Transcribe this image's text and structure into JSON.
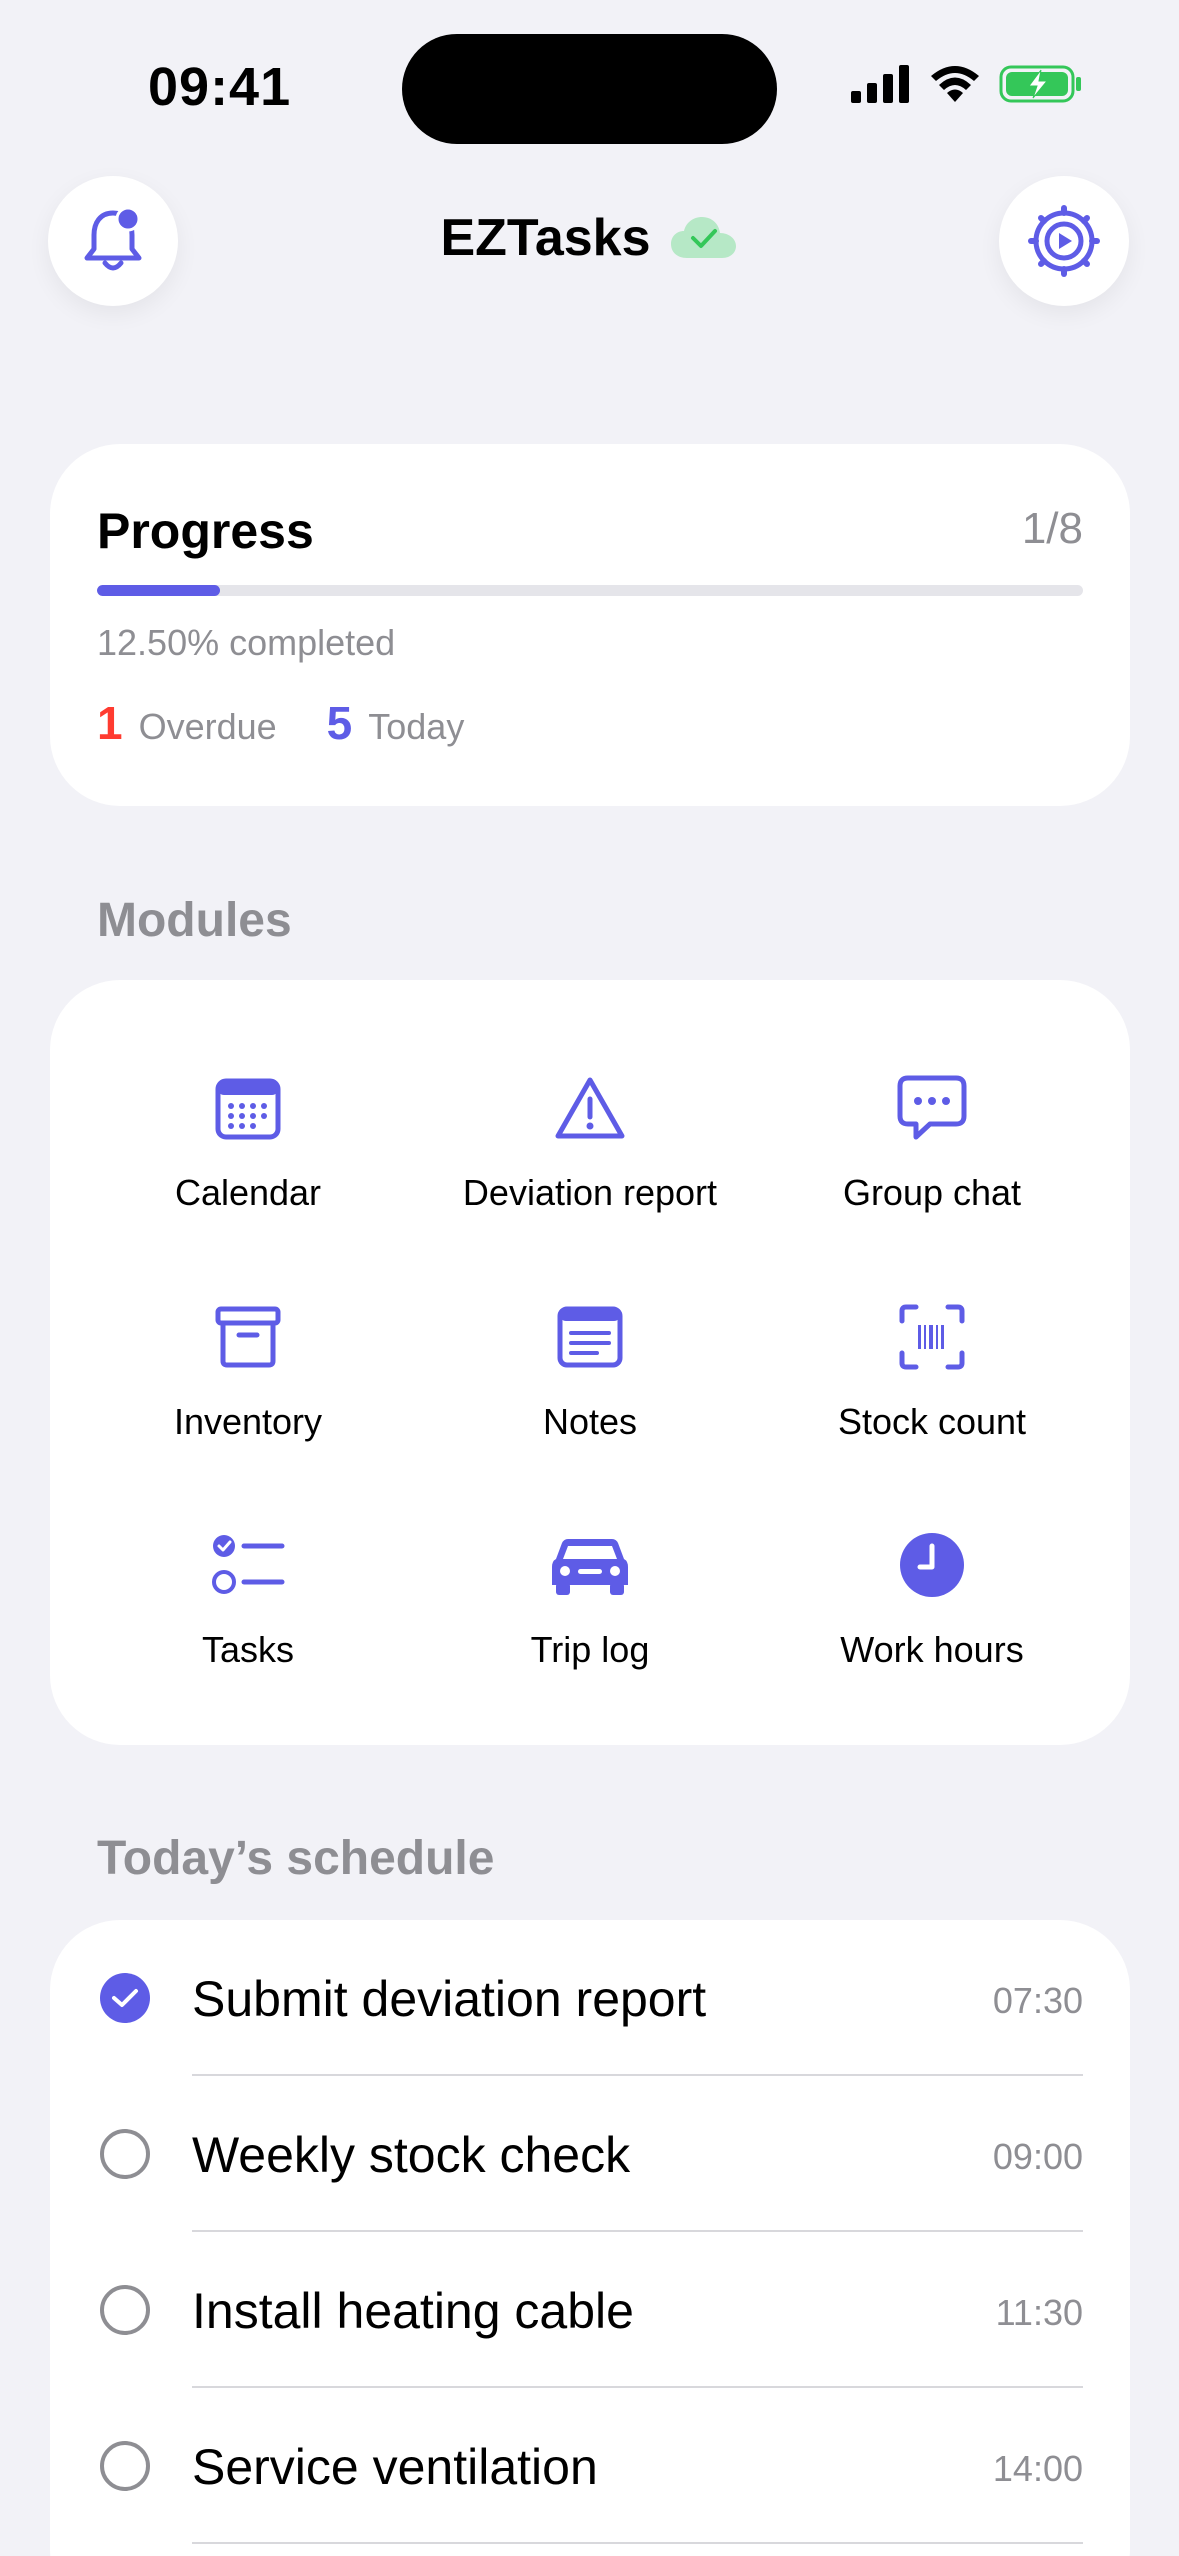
{
  "status_bar": {
    "time": "09:41"
  },
  "header": {
    "title": "EZTasks"
  },
  "progress": {
    "title": "Progress",
    "fraction": "1/8",
    "percent_text": "12.50% completed",
    "completed_fraction": 0.125,
    "overdue_count": "1",
    "overdue_label": "Overdue",
    "today_count": "5",
    "today_label": "Today"
  },
  "modules": {
    "title": "Modules",
    "items": [
      {
        "label": "Calendar",
        "icon": "calendar-icon"
      },
      {
        "label": "Deviation report",
        "icon": "warning-triangle-icon"
      },
      {
        "label": "Group chat",
        "icon": "chat-bubble-icon"
      },
      {
        "label": "Inventory",
        "icon": "archive-box-icon"
      },
      {
        "label": "Notes",
        "icon": "notes-icon"
      },
      {
        "label": "Stock count",
        "icon": "barcode-scanner-icon"
      },
      {
        "label": "Tasks",
        "icon": "checklist-icon"
      },
      {
        "label": "Trip log",
        "icon": "car-icon"
      },
      {
        "label": "Work hours",
        "icon": "clock-icon"
      }
    ]
  },
  "schedule": {
    "title": "Today’s schedule",
    "items": [
      {
        "title": "Submit deviation report",
        "time": "07:30",
        "done": true
      },
      {
        "title": "Weekly stock check",
        "time": "09:00",
        "done": false
      },
      {
        "title": "Install heating cable",
        "time": "11:30",
        "done": false
      },
      {
        "title": "Service ventilation",
        "time": "14:00",
        "done": false
      }
    ]
  },
  "colors": {
    "accent": "#5e5ce6",
    "overdue": "#ff3b30",
    "sync_ok": "#34c759",
    "background": "#f2f2f7"
  }
}
